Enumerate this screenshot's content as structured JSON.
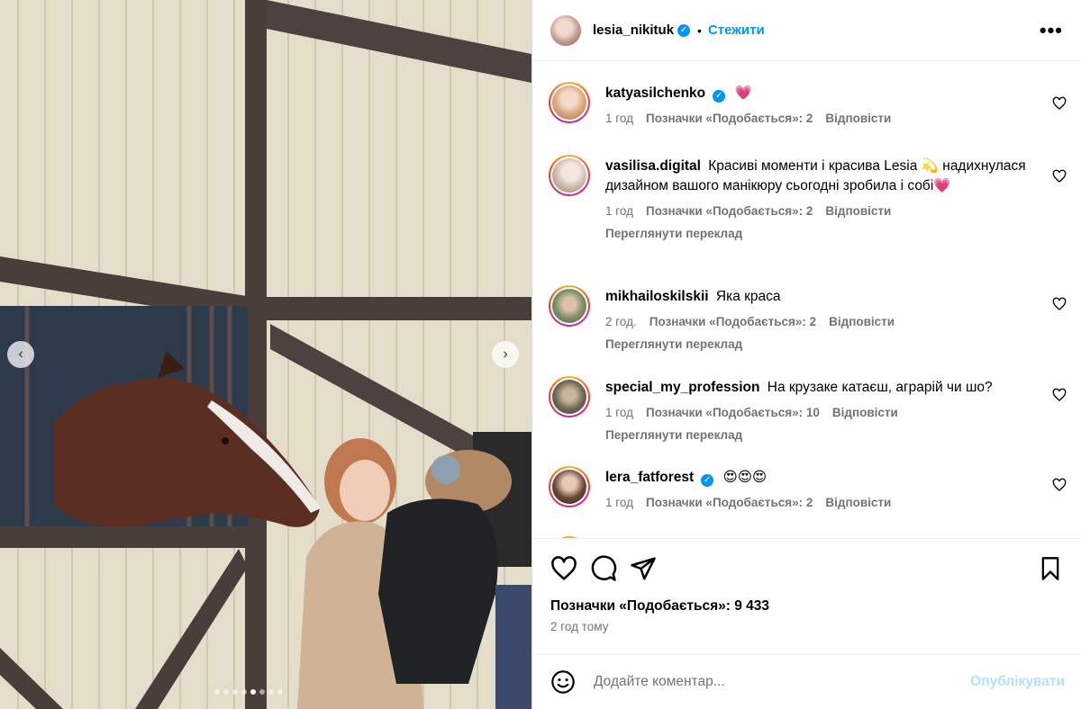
{
  "post": {
    "author": "lesia_nikituk",
    "verified": true,
    "separator": "•",
    "follow_label": "Стежити",
    "more_label": "•••"
  },
  "media": {
    "prev_label": "‹",
    "next_label": "›",
    "slides_total": 8,
    "active_slide": 5
  },
  "comments": [
    {
      "username": "katyasilchenko",
      "verified": true,
      "text": "💗",
      "time": "1 год",
      "likes": "Позначки «Подобається»: 2",
      "reply": "Відповісти",
      "translate": ""
    },
    {
      "username": "vasilisa.digital",
      "verified": false,
      "text": "Красиві моменти і красива Lesia 💫 надихнулася дизайном вашого манікюру сьогодні зробила і собі💗",
      "time": "1 год",
      "likes": "Позначки «Подобається»: 2",
      "reply": "Відповісти",
      "translate": "Переглянути переклад"
    },
    {
      "username": "mikhailoskilskii",
      "verified": false,
      "text": "Яка краса",
      "time": "2 год.",
      "likes": "Позначки «Подобається»: 2",
      "reply": "Відповісти",
      "translate": "Переглянути переклад"
    },
    {
      "username": "special_my_profession",
      "verified": false,
      "text": "На крузаке катаєш, аграрій чи шо?",
      "time": "1 год",
      "likes": "Позначки «Подобається»: 10",
      "reply": "Відповісти",
      "translate": "Переглянути переклад"
    },
    {
      "username": "lera_fatforest",
      "verified": true,
      "text": "😍😍😍",
      "time": "1 год",
      "likes": "Позначки «Подобається»: 2",
      "reply": "Відповісти",
      "translate": ""
    }
  ],
  "footer": {
    "likes": "Позначки «Подобається»: 9 433",
    "time": "2 год тому",
    "comment_placeholder": "Додайте коментар...",
    "publish_label": "Опублікувати"
  },
  "icons": {
    "like": "heart-icon",
    "comment": "comment-icon",
    "share": "share-icon",
    "save": "bookmark-icon",
    "emoji": "emoji-icon"
  },
  "colors": {
    "accent": "#0095f6",
    "publish_disabled": "#b2dffc",
    "muted": "#737373"
  }
}
